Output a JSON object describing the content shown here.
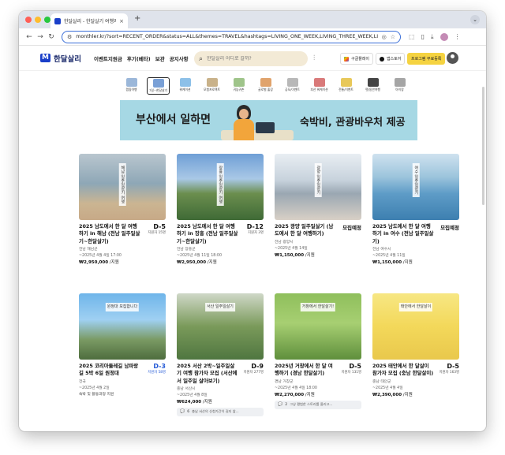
{
  "browser": {
    "tab_title": "한달살리 - 한달살기 여행지원금 신청",
    "tab_close": "×",
    "new_tab": "+",
    "tab_menu": "⌄",
    "url": "monthler.kr/?sort=RECENT_ORDER&status=ALL&themes=TRAVEL&hashtags=LIVING_ONE_WEEK,LIVING_THREE_WEEK,LIVIN...",
    "back": "←",
    "forward": "→",
    "reload": "↻",
    "traffic_colors": [
      "#ff5f57",
      "#febc2e",
      "#28c840"
    ]
  },
  "site": {
    "logo_mark": "M",
    "logo_text": "한달살리",
    "nav": [
      "이벤트지원금",
      "후기(베타)",
      "보관",
      "공지사항"
    ],
    "search_placeholder": "한달살리 어디로 갈까?",
    "google_play": "구글플레이",
    "app_store": "앱스토어",
    "register": "프로그램 무료등록"
  },
  "themes": [
    {
      "label": "캠핑여행",
      "color": "#9bb7d9",
      "active": false
    },
    {
      "label": "7일~한달살기",
      "color": "#7aa0d6",
      "active": true
    },
    {
      "label": "워케이션",
      "color": "#8dc0e8",
      "active": false
    },
    {
      "label": "모험프로젝트",
      "color": "#c9b28a",
      "active": false
    },
    {
      "label": "귀농귀촌",
      "color": "#9fc48a",
      "active": false
    },
    {
      "label": "글로벌 출장",
      "color": "#e0a36c",
      "active": false
    },
    {
      "label": "공모/이벤트",
      "color": "#b8b8b8",
      "active": false
    },
    {
      "label": "부산 워케이션",
      "color": "#d97a7a",
      "active": false
    },
    {
      "label": "전통/이벤트",
      "color": "#e8c85a",
      "active": false
    },
    {
      "label": "펫/동반여행",
      "color": "#444444",
      "active": false
    },
    {
      "label": "아이랑",
      "color": "#a5a5a5",
      "active": false
    }
  ],
  "banner": {
    "left": "부산에서 일하면",
    "right": "숙박비, 관광바우처 제공"
  },
  "cards": [
    {
      "title": "2025 남도에서 한 달 여행하기 in 해남 (전남 일주일살기~한달살기)",
      "dday": "D-5",
      "applicants": "지원자 15명",
      "region": "전남 해남군",
      "date": "~2025년 4월 4일 17:00",
      "price": "₩2,950,000",
      "price_unit": " /지원",
      "thumb_bg": "linear-gradient(180deg,#b9c6cf 0%,#8ea7b6 45%,#cbb592 75%,#c7a987 100%)",
      "caption": "해남 일주일살기 여행"
    },
    {
      "title": "2025 남도에서 한 달 여행하기 in 장흥 (전남 일주일살기~한달살기)",
      "dday": "D-12",
      "applicants": "지원자 3명",
      "region": "전남 장흥군",
      "date": "~2025년 4월 11일 18:00",
      "price": "₩2,950,000",
      "price_unit": " /지원",
      "thumb_bg": "linear-gradient(180deg,#6f9fd6 0%,#a9c8e6 38%,#6b8e4e 60%,#3f6a36 100%)",
      "caption": "장흥 일주일살기 여행"
    },
    {
      "title": "2025 광양 일주일살기 (남도에서 한 달 여행하기)",
      "dday": "모집예정",
      "applicants": "",
      "region": "전남 광양시",
      "date": "~2025년 4월 14일",
      "price": "₩1,150,000",
      "price_unit": " /지원",
      "thumb_bg": "linear-gradient(180deg,#e9eef3 0%,#c7d2dc 40%,#9aa7b2 60%,#d8d0c6 100%)",
      "caption": "광양 일주일살기"
    },
    {
      "title": "2025 남도에서 한 달 여행하기 in 여수 (전남 일주일살기)",
      "dday": "모집예정",
      "applicants": "",
      "region": "전남 여수시",
      "date": "~2025년 4월 11일",
      "price": "₩1,150,000",
      "price_unit": " /지원",
      "thumb_bg": "linear-gradient(180deg,#cfe2ef 0%,#9cc4dc 35%,#5e9cc7 60%,#3d7fb0 100%)",
      "caption": "여수 일주일살기"
    },
    {
      "title": "2025 코리아둘레길 남파랑길 5박 6일 원정대",
      "dday": "D-3",
      "applicants": "지원자 58명",
      "region": "전국",
      "date": "~2025년 4월 2일",
      "tags": "숙박 및 활동과정 지원",
      "thumb_bg": "linear-gradient(180deg,#6fb5ea 0%,#9fd0f2 40%,#7a9a64 70%,#4e6d3e 100%)",
      "caption": "원정대 모집합니다"
    },
    {
      "title": "2025 서산 2박~일주일살기 여행 참가자 모집 (서산에서 일주일 살아보기)",
      "dday": "D-9",
      "applicants": "지원자 277명",
      "region": "충남 서산시",
      "date": "~2025년 4월 8일",
      "price": "₩624,000",
      "price_unit": " /지원",
      "comment_count": "6",
      "comment_text": "충남 서산의 신청기간이 길지 않...",
      "thumb_bg": "linear-gradient(180deg,#cfd8c8 0%,#7a9a5a 50%,#4f7640 100%)",
      "caption": "서산 일주일살기"
    },
    {
      "title": "2025년 거창에서 한 달 여행하기 (경남 한달살기)",
      "dday": "D-5",
      "applicants": "지원자 131명",
      "region": "경남 거창군",
      "date": "~2025년 4월 4일 18:00",
      "price": "₩2,270,000",
      "price_unit": " /지원",
      "comment_count": "2",
      "comment_text": "그냥 평범한 스토리를 올리고...",
      "thumb_bg": "linear-gradient(180deg,#8fbf5c 0%,#a7cf72 45%,#5f8f3c 100%)",
      "caption": "거창에서 한달살기!"
    },
    {
      "title": "2025 태안에서 한 달살이 참가자 모집 (충남 한달살이)",
      "dday": "D-5",
      "applicants": "지원자 163명",
      "region": "충남 태안군",
      "date": "~2025년 4월 4일",
      "price": "₩2,390,000",
      "price_unit": " /지원",
      "thumb_bg": "linear-gradient(180deg,#f7e784 0%,#f3d85a 50%,#e9c84c 100%)",
      "caption": "태안에서 한달살이"
    }
  ]
}
